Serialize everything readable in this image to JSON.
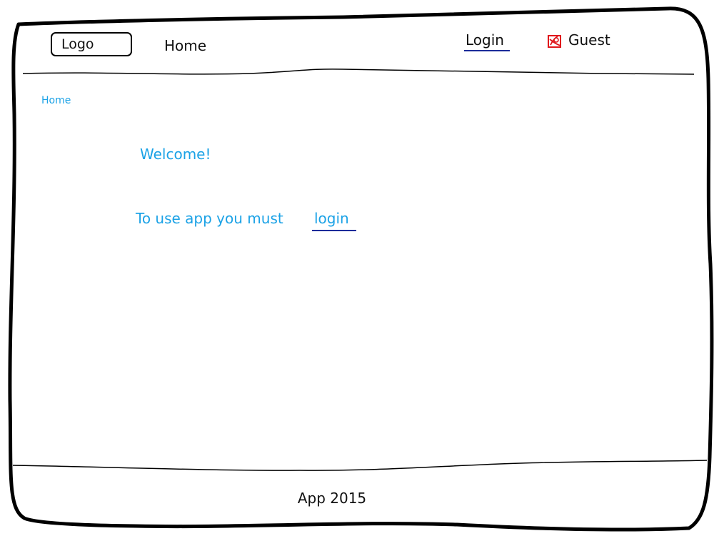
{
  "header": {
    "logo_label": "Logo",
    "nav_home": "Home",
    "login_link": "Login",
    "user_name": "Guest",
    "user_icon": "user-icon"
  },
  "breadcrumb": {
    "current": "Home"
  },
  "main": {
    "welcome_text": "Welcome!",
    "login_prompt": "To use app you must",
    "login_link": "login"
  },
  "footer": {
    "text": "App 2015"
  },
  "colors": {
    "accent_text": "#1ba2e6",
    "link_underline": "#1b2b9a",
    "icon_red": "#e0161b",
    "stroke": "#000000"
  }
}
